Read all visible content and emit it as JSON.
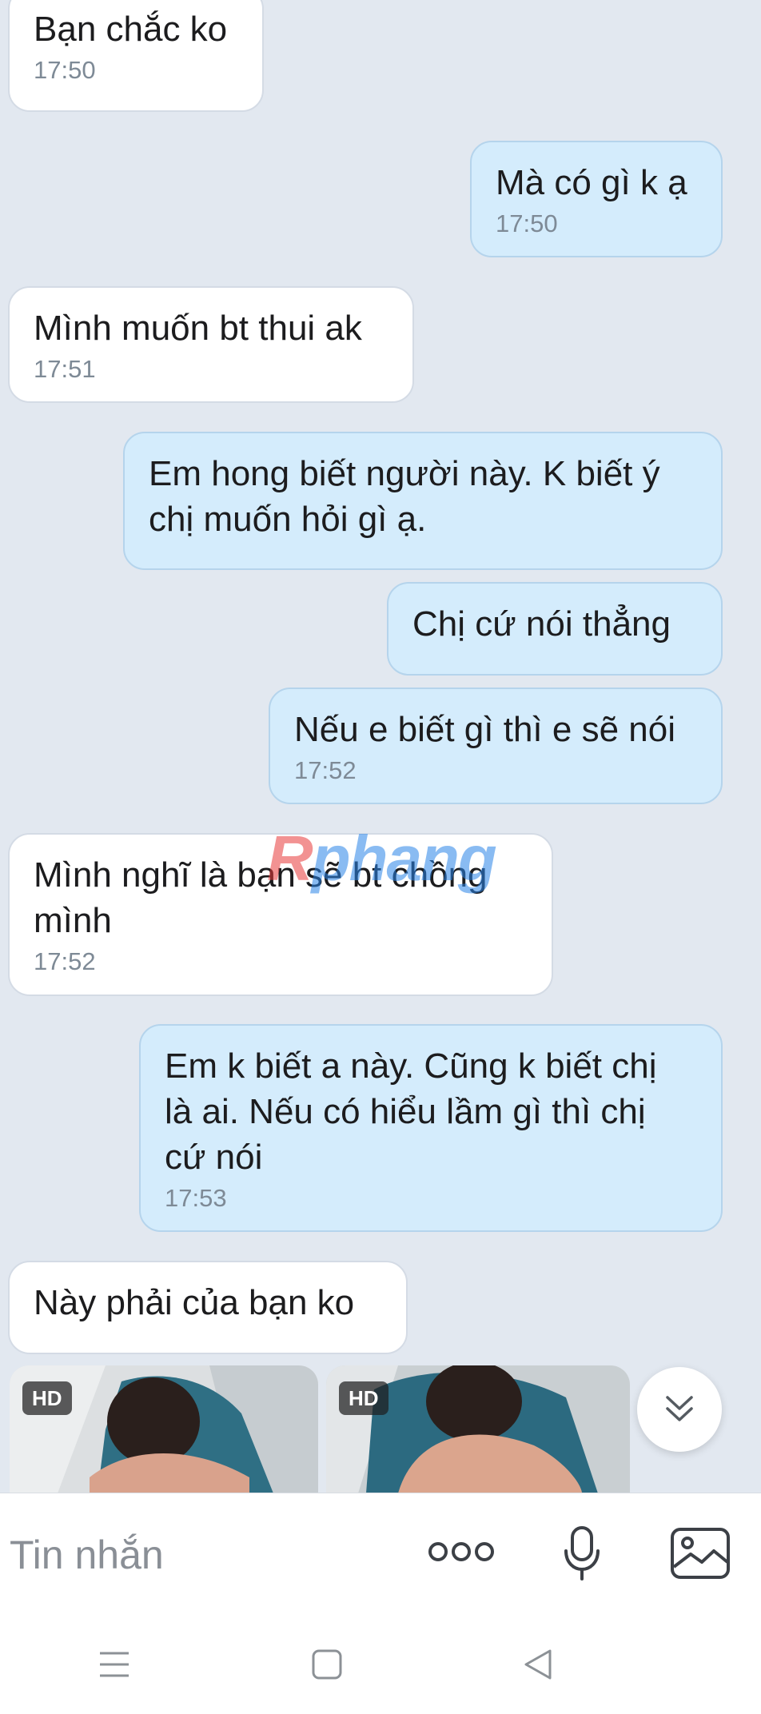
{
  "messages": [
    {
      "dir": "in",
      "text": "Bạn chắc ko",
      "time": "17:50"
    },
    {
      "dir": "out",
      "text": "Mà có gì k ạ",
      "time": "17:50"
    },
    {
      "dir": "in",
      "text": "Mình muốn bt thui ak",
      "time": "17:51"
    },
    {
      "dir": "out",
      "text": "Em hong biết người này. K biết ý\nchị muốn hỏi gì ạ.",
      "time": ""
    },
    {
      "dir": "out",
      "text": "Chị cứ nói thẳng",
      "time": ""
    },
    {
      "dir": "out",
      "text": "Nếu e biết gì thì e sẽ nói",
      "time": "17:52"
    },
    {
      "dir": "in",
      "text": "Mình nghĩ là bạn sẽ bt chồng\nmình",
      "time": "17:52"
    },
    {
      "dir": "out",
      "text": "Em k biết a này. Cũng k biết chị\nlà ai. Nếu có hiểu lầm gì thì chị\ncứ nói",
      "time": "17:53"
    },
    {
      "dir": "in",
      "text": "Này phải của bạn ko",
      "time": ""
    }
  ],
  "watermark": {
    "part1": "R",
    "part2": "phang"
  },
  "media": [
    {
      "badge": "HD"
    },
    {
      "badge": "HD"
    }
  ],
  "composer": {
    "placeholder": "Tin nhắn"
  },
  "icons": {
    "scroll_down": "double-chevron-down-icon",
    "more": "more-dots-icon",
    "mic": "microphone-icon",
    "gallery": "image-gallery-icon",
    "nav_menu": "menu-lines-icon",
    "nav_home": "square-home-icon",
    "nav_back": "triangle-back-icon"
  },
  "colors": {
    "background": "#e2e8f0",
    "incoming_bubble": "#ffffff",
    "outgoing_bubble": "#d4ecfc",
    "time_text": "#7e8a96"
  }
}
